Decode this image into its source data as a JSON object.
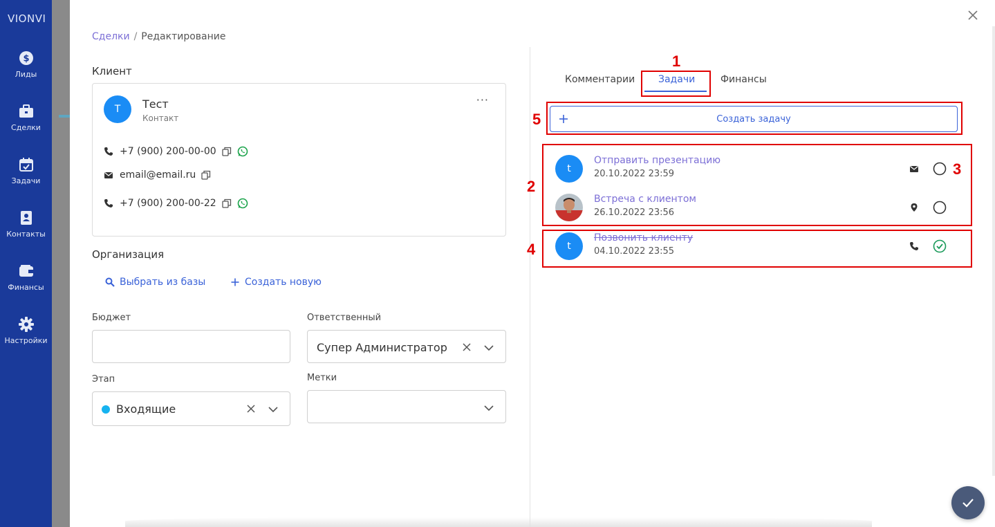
{
  "sidebar": {
    "brand": "VIONVI",
    "items": [
      {
        "label": "Лиды",
        "icon": "dollar-icon"
      },
      {
        "label": "Сделки",
        "icon": "briefcase-icon"
      },
      {
        "label": "Задачи",
        "icon": "calendar-check-icon"
      },
      {
        "label": "Контакты",
        "icon": "contact-book-icon"
      },
      {
        "label": "Финансы",
        "icon": "wallet-icon"
      },
      {
        "label": "Настройки",
        "icon": "gear-icon"
      }
    ],
    "color": "#1a3a9a"
  },
  "breadcrumb": {
    "parent": "Сделки",
    "separator": "/",
    "current": "Редактирование"
  },
  "client": {
    "section_title": "Клиент",
    "avatar_letter": "Т",
    "name": "Тест",
    "role": "Контакт",
    "more": "···",
    "phone1": "+7 (900) 200-00-00",
    "email": "email@email.ru",
    "phone2": "+7 (900) 200-00-22"
  },
  "organization": {
    "section_title": "Организация",
    "choose_label": "Выбрать из базы",
    "create_label": "Создать новую"
  },
  "form": {
    "budget_label": "Бюджет",
    "budget_value": "",
    "responsible_label": "Ответственный",
    "responsible_value": "Супер Администратор",
    "stage_label": "Этап",
    "stage_value": "Входящие",
    "stage_color": "#16b3f0",
    "tags_label": "Метки",
    "tags_value": ""
  },
  "tabs": [
    {
      "label": "Комментарии",
      "active": false
    },
    {
      "label": "Задачи",
      "active": true
    },
    {
      "label": "Финансы",
      "active": false
    }
  ],
  "create_task_label": "Создать задачу",
  "tasks": [
    {
      "avatar": "t",
      "title": "Отправить презентацию",
      "date": "20.10.2022 23:59",
      "type_icon": "envelope-icon",
      "done": false
    },
    {
      "avatar": "photo",
      "title": "Встреча с клиентом",
      "date": "26.10.2022 23:56",
      "type_icon": "map-pin-icon",
      "done": false
    },
    {
      "avatar": "t",
      "title": "Позвонить клиенту",
      "date": "04.10.2022 23:55",
      "type_icon": "phone-icon",
      "done": true
    }
  ],
  "annotations": [
    "1",
    "2",
    "3",
    "4",
    "5"
  ],
  "colors": {
    "accent": "#3a62d8",
    "link": "#7c6fd6",
    "highlight": "#e00000",
    "done": "#1a9a5a"
  }
}
